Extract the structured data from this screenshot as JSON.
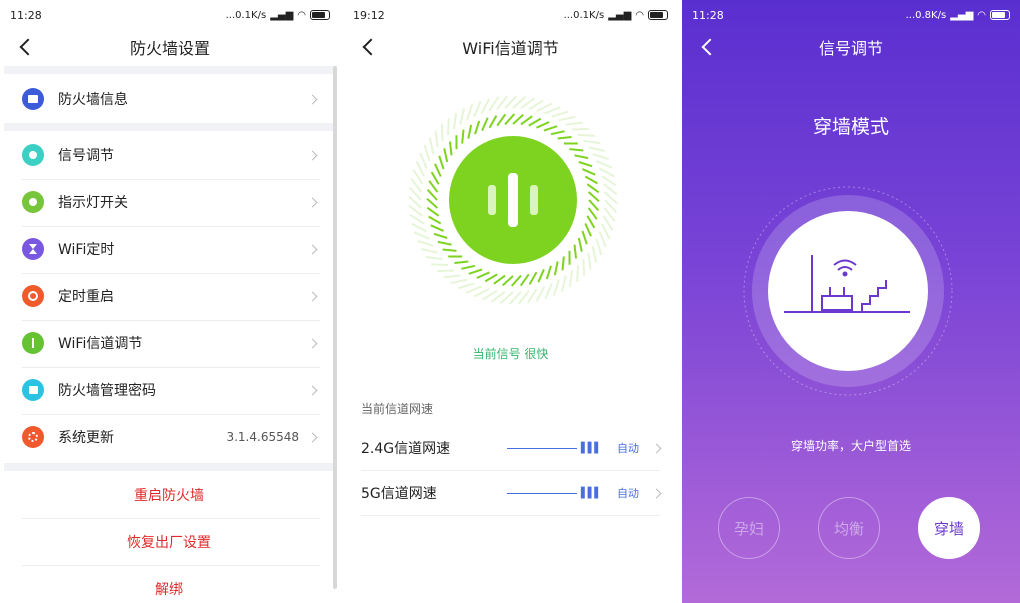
{
  "screen1": {
    "status": {
      "time": "11:28",
      "right": "...0.1K/s"
    },
    "title": "防火墙设置",
    "items": [
      {
        "label": "防火墙信息",
        "icon": "router-info-icon",
        "color": "#3b5bd9"
      },
      {
        "label": "信号调节",
        "icon": "signal-adjust-icon",
        "color": "#3ccfc3"
      },
      {
        "label": "指示灯开关",
        "icon": "light-bulb-icon",
        "color": "#77c53a"
      },
      {
        "label": "WiFi定时",
        "icon": "hourglass-icon",
        "color": "#7a57e0"
      },
      {
        "label": "定时重启",
        "icon": "power-icon",
        "color": "#f15a2b"
      },
      {
        "label": "WiFi信道调节",
        "icon": "channel-icon",
        "color": "#65c232"
      },
      {
        "label": "防火墙管理密码",
        "icon": "lock-icon",
        "color": "#2cc3e3"
      },
      {
        "label": "系统更新",
        "icon": "update-icon",
        "color": "#f0582e",
        "value": "3.1.4.65548"
      }
    ],
    "actions": [
      "重启防火墙",
      "恢复出厂设置",
      "解绑"
    ]
  },
  "screen2": {
    "status": {
      "time": "19:12",
      "right": "...0.1K/s"
    },
    "title": "WiFi信道调节",
    "signal_text": "当前信号 很快",
    "section_title": "当前信道网速",
    "rows": [
      {
        "label": "2.4G信道网速",
        "mode": "自动"
      },
      {
        "label": "5G信道网速",
        "mode": "自动"
      }
    ],
    "accent": "#7ed321"
  },
  "screen3": {
    "status": {
      "time": "11:28",
      "right": "...0.8K/s"
    },
    "title": "信号调节",
    "mode_title": "穿墙模式",
    "mode_desc": "穿墙功率，大户型首选",
    "modes": [
      {
        "label": "孕妇",
        "active": false
      },
      {
        "label": "均衡",
        "active": false
      },
      {
        "label": "穿墙",
        "active": true
      }
    ],
    "accent": "#6a38cf"
  }
}
